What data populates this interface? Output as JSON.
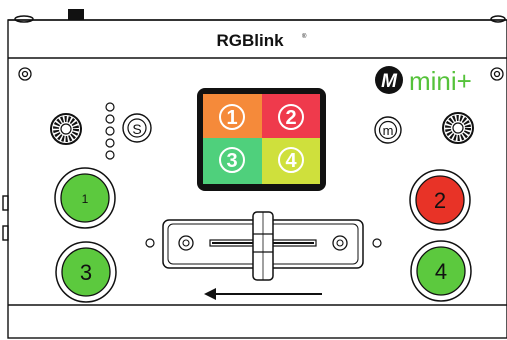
{
  "device": {
    "brand": "RGBlink",
    "brand_mark": "®",
    "model_letter": "M",
    "model_name": "mini+"
  },
  "side_buttons": {
    "s_label": "S",
    "m_label": "m"
  },
  "screen": {
    "quadrants": [
      {
        "number": "1",
        "color": "#f58a3a"
      },
      {
        "number": "2",
        "color": "#ef3a4c"
      },
      {
        "number": "3",
        "color": "#4fd07c"
      },
      {
        "number": "4",
        "color": "#cfe03c"
      }
    ]
  },
  "input_buttons": [
    {
      "label": "1",
      "color": "#5cc93e",
      "state": "preview"
    },
    {
      "label": "2",
      "color": "#e83327",
      "state": "program"
    },
    {
      "label": "3",
      "color": "#5cc93e",
      "state": "preview"
    },
    {
      "label": "4",
      "color": "#5cc93e",
      "state": "preview"
    }
  ],
  "colors": {
    "outline": "#1a1a1a",
    "brand_green": "#55c23a"
  }
}
